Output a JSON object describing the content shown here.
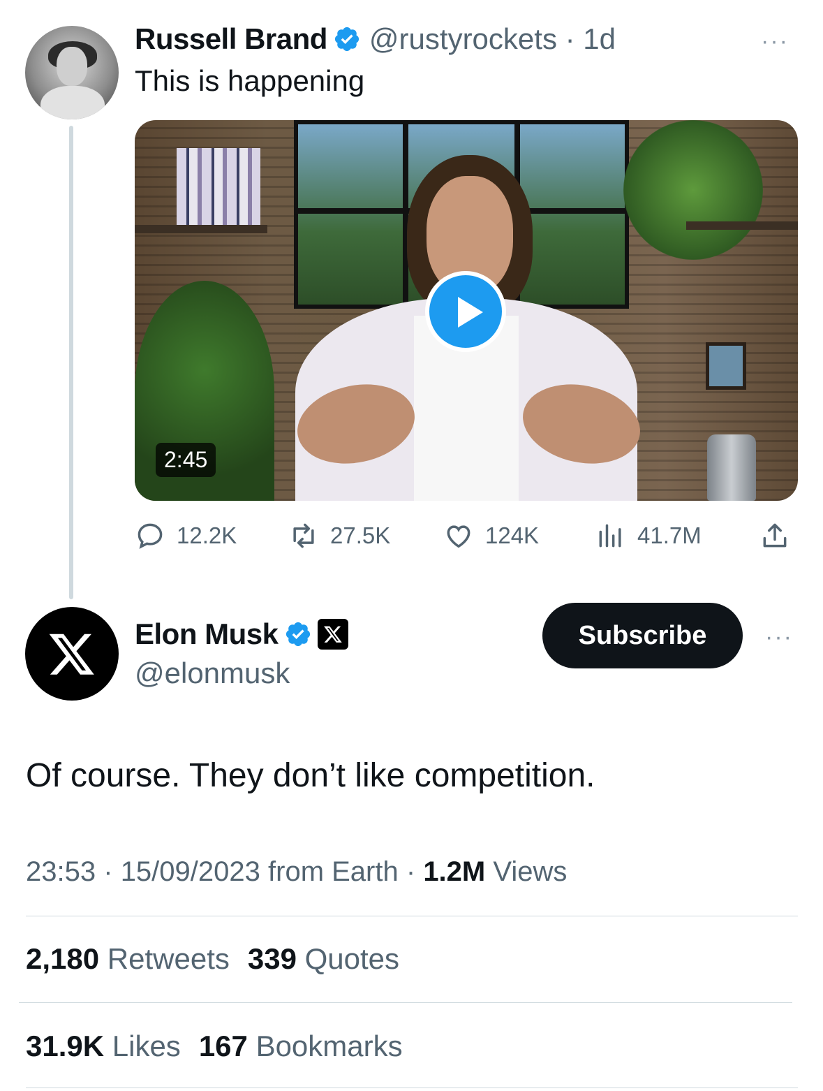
{
  "quoted_tweet": {
    "author_name": "Russell Brand",
    "handle": "@rustyrockets",
    "separator": "·",
    "time_ago": "1d",
    "text": "This is happening",
    "video_duration": "2:45",
    "more_label": "···",
    "metrics": {
      "replies": "12.2K",
      "retweets": "27.5K",
      "likes": "124K",
      "views": "41.7M"
    }
  },
  "main_tweet": {
    "author_name": "Elon Musk",
    "handle": "@elonmusk",
    "subscribe_label": "Subscribe",
    "more_label": "···",
    "text": "Of course. They don’t like competition.",
    "time": "23:53",
    "date": "15/09/2023",
    "source": "from Earth",
    "sep": "·",
    "views_count": "1.2M",
    "views_label": "Views",
    "retweets_count": "2,180",
    "retweets_label": "Retweets",
    "quotes_count": "339",
    "quotes_label": "Quotes",
    "likes_count": "31.9K",
    "likes_label": "Likes",
    "bookmarks_count": "167",
    "bookmarks_label": "Bookmarks"
  },
  "colors": {
    "verified_blue": "#1d9bf0",
    "text_primary": "#0f1419",
    "text_secondary": "#536471",
    "divider": "#cfd9de"
  }
}
